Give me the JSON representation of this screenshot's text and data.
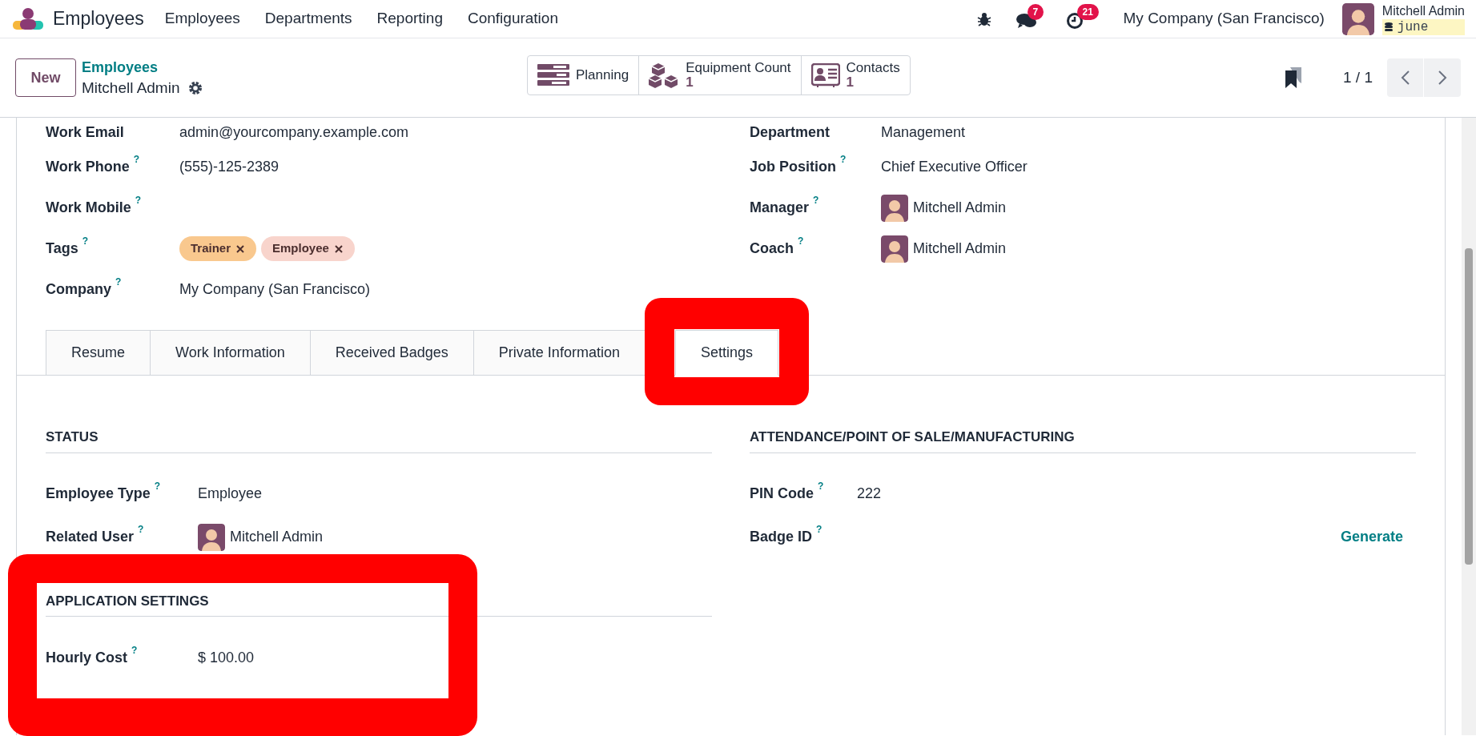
{
  "app": {
    "name": "Employees"
  },
  "menu": [
    {
      "label": "Employees"
    },
    {
      "label": "Departments"
    },
    {
      "label": "Reporting"
    },
    {
      "label": "Configuration"
    }
  ],
  "systray": {
    "messages_count": "7",
    "activities_count": "21",
    "company": "My Company (San Francisco)",
    "user": {
      "name": "Mitchell Admin",
      "database": "june"
    }
  },
  "control_panel": {
    "new_button": "New",
    "breadcrumb": "Employees",
    "record": "Mitchell Admin",
    "smart_buttons": [
      {
        "kind": "planning",
        "label": "Planning"
      },
      {
        "kind": "equipment",
        "label": "Equipment Count",
        "value": "1"
      },
      {
        "kind": "contacts",
        "label": "Contacts",
        "value": "1"
      }
    ],
    "pager": "1 / 1"
  },
  "fields_left": [
    {
      "kind": "text",
      "label": "Work Email",
      "value": "admin@yourcompany.example.com"
    },
    {
      "kind": "text",
      "label": "Work Phone",
      "help": "?",
      "value": "(555)-125-2389"
    },
    {
      "kind": "text",
      "label": "Work Mobile",
      "help": "?"
    },
    {
      "kind": "tags",
      "label": "Tags",
      "help": "?",
      "tags": [
        {
          "label": "Trainer",
          "color": "#f9c88e"
        },
        {
          "label": "Employee",
          "color": "#f8d4cc"
        }
      ]
    },
    {
      "kind": "text",
      "label": "Company",
      "help": "?",
      "value": "My Company (San Francisco)"
    }
  ],
  "fields_right": [
    {
      "kind": "text",
      "label": "Department",
      "value": "Management"
    },
    {
      "kind": "text",
      "label": "Job Position",
      "help": "?",
      "value": "Chief Executive Officer"
    },
    {
      "kind": "user",
      "label": "Manager",
      "help": "?",
      "value": "Mitchell Admin"
    },
    {
      "kind": "user",
      "label": "Coach",
      "help": "?",
      "value": "Mitchell Admin"
    }
  ],
  "tabs": [
    {
      "label": "Resume",
      "selected": false
    },
    {
      "label": "Work Information",
      "selected": false
    },
    {
      "label": "Received Badges",
      "selected": false
    },
    {
      "label": "Private Information",
      "selected": false
    },
    {
      "label": "Settings",
      "selected": true
    }
  ],
  "sections_left": [
    {
      "title": "STATUS",
      "fields": [
        {
          "kind": "text",
          "label": "Employee Type",
          "help": "?",
          "value": "Employee"
        },
        {
          "kind": "user",
          "label": "Related User",
          "help": "?",
          "value": "Mitchell Admin"
        }
      ]
    },
    {
      "title": "APPLICATION SETTINGS",
      "fields": [
        {
          "kind": "text",
          "label": "Hourly Cost",
          "help": "?",
          "value": "$ 100.00"
        }
      ]
    }
  ],
  "sections_right": [
    {
      "title": "ATTENDANCE/POINT OF SALE/MANUFACTURING",
      "fields": [
        {
          "kind": "text",
          "label": "PIN Code",
          "help": "?",
          "value": "222"
        },
        {
          "kind": "action",
          "label": "Badge ID",
          "help": "?",
          "action": "Generate"
        }
      ]
    }
  ]
}
